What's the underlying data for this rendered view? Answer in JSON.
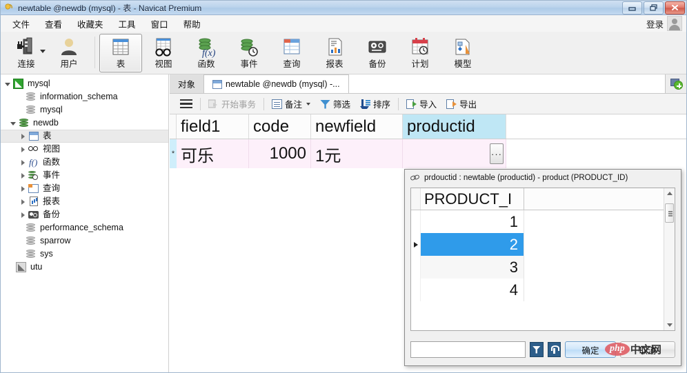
{
  "window": {
    "title": "newtable @newdb (mysql) - 表 - Navicat Premium",
    "icon": "navicat-logo-icon",
    "minimize": "–",
    "restore": "❐",
    "close": "✕"
  },
  "menubar": {
    "items": [
      {
        "label": "文件",
        "name": "menu-file"
      },
      {
        "label": "查看",
        "name": "menu-view"
      },
      {
        "label": "收藏夹",
        "name": "menu-favorites"
      },
      {
        "label": "工具",
        "name": "menu-tools"
      },
      {
        "label": "窗口",
        "name": "menu-window"
      },
      {
        "label": "帮助",
        "name": "menu-help"
      }
    ],
    "login_label": "登录"
  },
  "toolbar": {
    "buttons": [
      {
        "label": "连接",
        "name": "toolbar-connection",
        "icon": "server-plug-icon",
        "caret": true
      },
      {
        "label": "用户",
        "name": "toolbar-user",
        "icon": "user-icon",
        "caret": false
      },
      {
        "label": "表",
        "name": "toolbar-table",
        "icon": "table-grid-icon",
        "caret": false,
        "active": true
      },
      {
        "label": "视图",
        "name": "toolbar-view",
        "icon": "glasses-view-icon",
        "caret": false
      },
      {
        "label": "函数",
        "name": "toolbar-function",
        "icon": "fx-function-icon",
        "caret": false
      },
      {
        "label": "事件",
        "name": "toolbar-event",
        "icon": "event-clock-icon",
        "caret": false
      },
      {
        "label": "查询",
        "name": "toolbar-query",
        "icon": "query-icon",
        "caret": false
      },
      {
        "label": "报表",
        "name": "toolbar-report",
        "icon": "report-chart-icon",
        "caret": false
      },
      {
        "label": "备份",
        "name": "toolbar-backup",
        "icon": "backup-tape-icon",
        "caret": false
      },
      {
        "label": "计划",
        "name": "toolbar-schedule",
        "icon": "calendar-clock-icon",
        "caret": false
      },
      {
        "label": "模型",
        "name": "toolbar-model",
        "icon": "model-diagram-icon",
        "caret": false
      }
    ]
  },
  "sidebar": {
    "nodes": [
      {
        "label": "mysql",
        "indent": 0,
        "expander": "open",
        "icon": "connection-icon",
        "name": "tree-connection-mysql"
      },
      {
        "label": "information_schema",
        "indent": 1,
        "expander": "none",
        "icon": "database-gray-icon",
        "name": "tree-db-information-schema"
      },
      {
        "label": "mysql",
        "indent": 1,
        "expander": "none",
        "icon": "database-gray-icon",
        "name": "tree-db-mysql"
      },
      {
        "label": "newdb",
        "indent": 1,
        "expander": "open",
        "icon": "database-green-icon",
        "name": "tree-db-newdb"
      },
      {
        "label": "表",
        "indent": 2,
        "expander": "closed",
        "icon": "table-icon",
        "name": "tree-node-tables",
        "selected": true
      },
      {
        "label": "视图",
        "indent": 2,
        "expander": "closed",
        "icon": "view-icon",
        "name": "tree-node-views"
      },
      {
        "label": "函数",
        "indent": 2,
        "expander": "closed",
        "icon": "function-icon",
        "name": "tree-node-functions"
      },
      {
        "label": "事件",
        "indent": 2,
        "expander": "closed",
        "icon": "event-icon",
        "name": "tree-node-events"
      },
      {
        "label": "查询",
        "indent": 2,
        "expander": "closed",
        "icon": "query-icon",
        "name": "tree-node-queries"
      },
      {
        "label": "报表",
        "indent": 2,
        "expander": "closed",
        "icon": "report-icon",
        "name": "tree-node-reports"
      },
      {
        "label": "备份",
        "indent": 2,
        "expander": "closed",
        "icon": "backup-icon",
        "name": "tree-node-backups"
      },
      {
        "label": "performance_schema",
        "indent": 1,
        "expander": "none",
        "icon": "database-gray-icon",
        "name": "tree-db-performance-schema"
      },
      {
        "label": "sparrow",
        "indent": 1,
        "expander": "none",
        "icon": "database-gray-icon",
        "name": "tree-db-sparrow"
      },
      {
        "label": "sys",
        "indent": 1,
        "expander": "none",
        "icon": "database-gray-icon",
        "name": "tree-db-sys"
      },
      {
        "label": "utu",
        "indent": 0,
        "expander": "none",
        "icon": "connection-gray-icon",
        "name": "tree-connection-utu"
      }
    ]
  },
  "tabs": {
    "items": [
      {
        "label": "对象",
        "name": "tab-objects",
        "active": false,
        "has_icon": false
      },
      {
        "label": "newtable @newdb (mysql) -...",
        "name": "tab-newtable",
        "active": true,
        "has_icon": true
      }
    ],
    "new_tab_icon": "new-tab-plus-icon"
  },
  "grid_toolbar": {
    "menu_icon": "hamburger-menu-icon",
    "items": [
      {
        "label": "开始事务",
        "name": "begin-transaction-button",
        "icon": "transaction-icon",
        "disabled": true,
        "caret": false
      },
      {
        "label": "备注",
        "name": "note-button",
        "icon": "note-icon",
        "disabled": false,
        "caret": true
      },
      {
        "label": "筛选",
        "name": "filter-button",
        "icon": "filter-icon",
        "disabled": false,
        "caret": false
      },
      {
        "label": "排序",
        "name": "sort-button",
        "icon": "sort-icon",
        "disabled": false,
        "caret": false
      },
      {
        "label": "导入",
        "name": "import-button",
        "icon": "import-icon",
        "disabled": false,
        "caret": false
      },
      {
        "label": "导出",
        "name": "export-button",
        "icon": "export-icon",
        "disabled": false,
        "caret": false
      }
    ]
  },
  "datagrid": {
    "columns": [
      {
        "label": "field1",
        "name": "column-field1",
        "width": 105,
        "highlight": false
      },
      {
        "label": "code",
        "name": "column-code",
        "width": 90,
        "highlight": false
      },
      {
        "label": "newfield",
        "name": "column-newfield",
        "width": 133,
        "highlight": false
      },
      {
        "label": "productid",
        "name": "column-productid",
        "width": 150,
        "highlight": true
      }
    ],
    "row_marker": "*",
    "row": {
      "field1": "可乐",
      "code": "1000",
      "newfield": "1元",
      "productid": ""
    },
    "ellipsis_label": "···"
  },
  "dialog": {
    "title": "prdouctid  : newtable (productid) - product (PRODUCT_ID)",
    "link_icon": "link-chain-icon",
    "list": {
      "column_header": "PRODUCT_I",
      "rows": [
        {
          "value": "1",
          "selected": false
        },
        {
          "value": "2",
          "selected": true
        },
        {
          "value": "3",
          "selected": false
        },
        {
          "value": "4",
          "selected": false
        }
      ]
    },
    "search_value": "",
    "search_placeholder": "",
    "filter_button_icon": "filter-funnel-icon",
    "settings_button_icon": "wrench-icon",
    "ok_label": "确定",
    "cancel_label": "取消",
    "scrollbar": {
      "up_icon": "scroll-up-arrow-icon",
      "down_icon": "scroll-down-arrow-icon"
    }
  },
  "watermark": {
    "php": "php",
    "cn": "中文网"
  },
  "colors": {
    "accent_blue": "#2f9bea",
    "header_highlight": "#bfe7f5",
    "row_pink": "#fdf0fa",
    "row_marker_blue": "#cfeefb",
    "toolbar_bg": "#f0f0f0",
    "watermark_red": "#e05b62"
  }
}
